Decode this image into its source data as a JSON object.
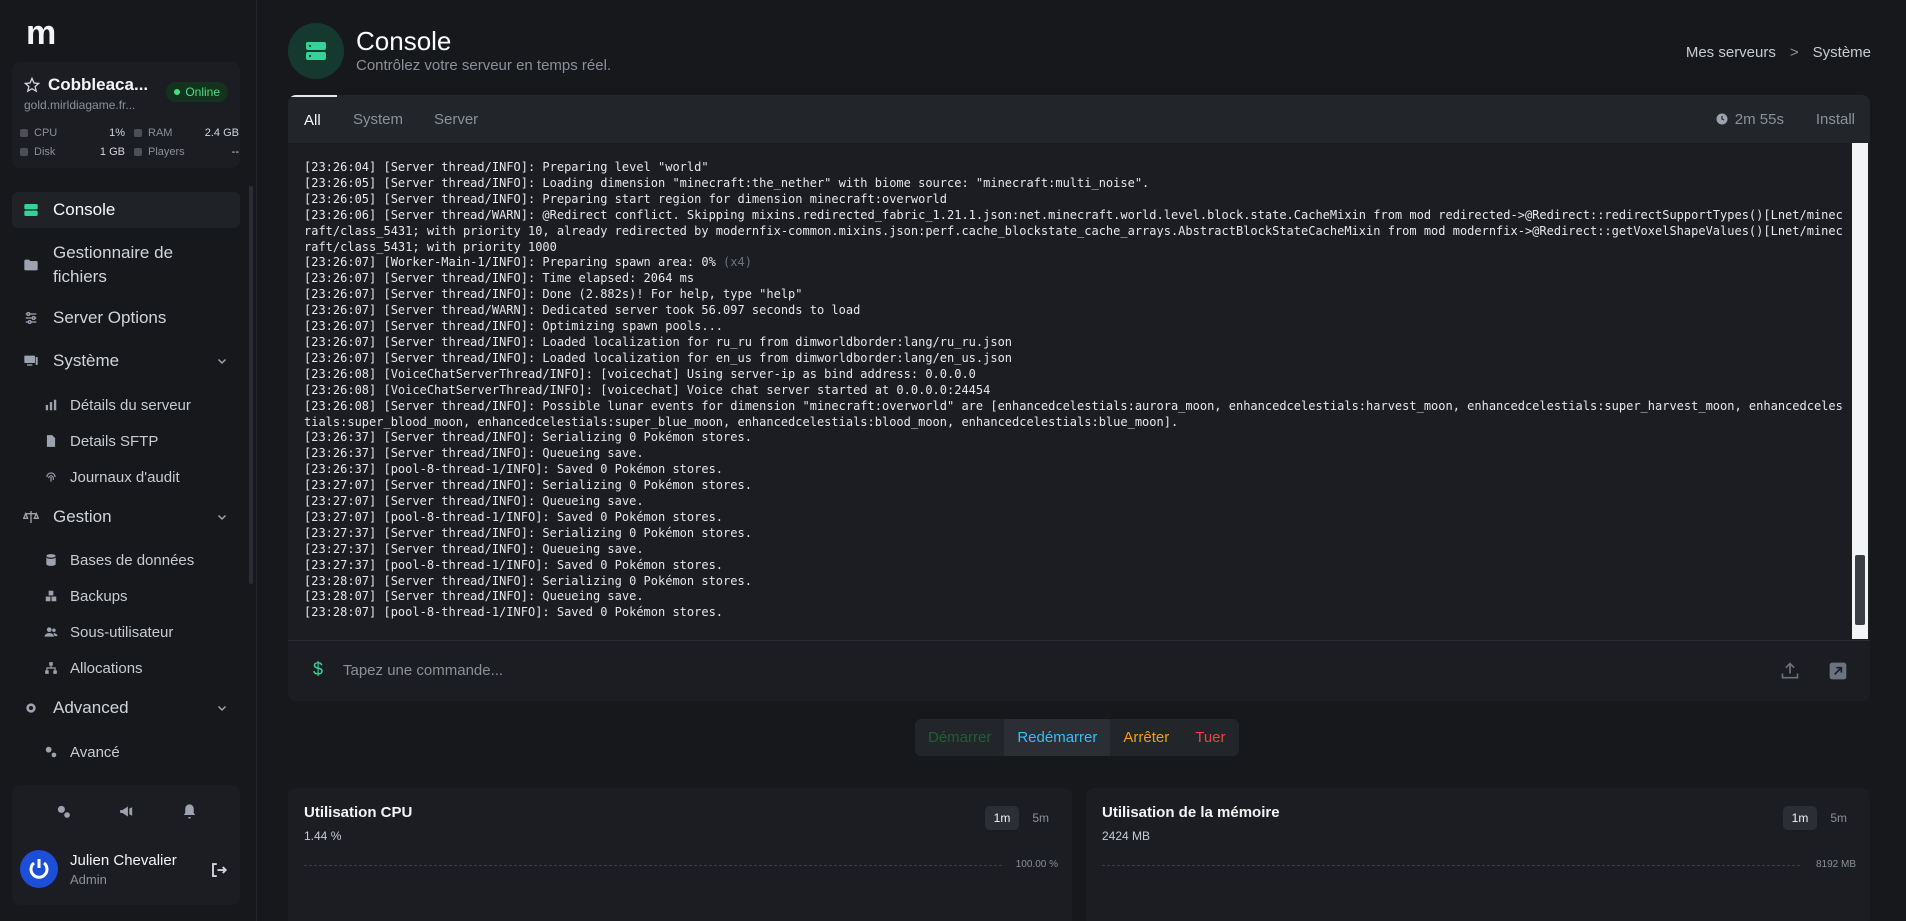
{
  "logo": "m",
  "server": {
    "name": "Cobbleaca...",
    "status": "Online",
    "host": "gold.mirldiagame.fr...",
    "stats": [
      {
        "label": "CPU",
        "value": "1%"
      },
      {
        "label": "RAM",
        "value": "2.4 GB"
      },
      {
        "label": "Disk",
        "value": "1 GB"
      },
      {
        "label": "Players",
        "value": "--"
      }
    ]
  },
  "nav": {
    "console": "Console",
    "files_line1": "Gestionnaire de",
    "files_line2": "fichiers",
    "server_options": "Server Options",
    "systeme": "Système",
    "systeme_items": [
      "Détails du serveur",
      "Details SFTP",
      "Journaux d'audit"
    ],
    "gestion": "Gestion",
    "gestion_items": [
      "Bases de données",
      "Backups",
      "Sous-utilisateur",
      "Allocations"
    ],
    "advanced": "Advanced",
    "advanced_items": [
      "Avancé"
    ]
  },
  "user": {
    "name": "Julien Chevalier",
    "role": "Admin"
  },
  "header": {
    "title": "Console",
    "subtitle": "Contrôlez votre serveur en temps réel.",
    "breadcrumb": [
      "Mes serveurs",
      ">",
      "Système"
    ]
  },
  "console": {
    "tabs": [
      "All",
      "System",
      "Server"
    ],
    "uptime": "2m 55s",
    "install": "Install",
    "lines": [
      "[23:26:04] [Server thread/INFO]: Preparing level \"world\"",
      "[23:26:05] [Server thread/INFO]: Loading dimension \"minecraft:the_nether\" with biome source: \"minecraft:multi_noise\".",
      "[23:26:05] [Server thread/INFO]: Preparing start region for dimension minecraft:overworld",
      "[23:26:06] [Server thread/WARN]: @Redirect conflict. Skipping mixins.redirected_fabric_1.21.1.json:net.minecraft.world.level.block.state.CacheMixin from mod redirected->@Redirect::redirectSupportTypes()[Lnet/minecraft/class_5431; with priority 10, already redirected by modernfix-common.mixins.json:perf.cache_blockstate_cache_arrays.AbstractBlockStateCacheMixin from mod modernfix->@Redirect::getVoxelShapeValues()[Lnet/minecraft/class_5431; with priority 1000",
      "[23:26:07] [Worker-Main-1/INFO]: Preparing spawn area: 0%",
      "[23:26:07] [Server thread/INFO]: Time elapsed: 2064 ms",
      "[23:26:07] [Server thread/INFO]: Done (2.882s)! For help, type \"help\"",
      "[23:26:07] [Server thread/WARN]: Dedicated server took 56.097 seconds to load",
      "[23:26:07] [Server thread/INFO]: Optimizing spawn pools...",
      "[23:26:07] [Server thread/INFO]: Loaded localization for ru_ru from dimworldborder:lang/ru_ru.json",
      "[23:26:07] [Server thread/INFO]: Loaded localization for en_us from dimworldborder:lang/en_us.json",
      "[23:26:08] [VoiceChatServerThread/INFO]: [voicechat] Using server-ip as bind address: 0.0.0.0",
      "[23:26:08] [VoiceChatServerThread/INFO]: [voicechat] Voice chat server started at 0.0.0.0:24454",
      "[23:26:08] [Server thread/INFO]: Possible lunar events for dimension \"minecraft:overworld\" are [enhancedcelestials:aurora_moon, enhancedcelestials:harvest_moon, enhancedcelestials:super_harvest_moon, enhancedcelestials:super_blood_moon, enhancedcelestials:super_blue_moon, enhancedcelestials:blood_moon, enhancedcelestials:blue_moon].",
      "[23:26:37] [Server thread/INFO]: Serializing 0 Pokémon stores.",
      "[23:26:37] [Server thread/INFO]: Queueing save.",
      "[23:26:37] [pool-8-thread-1/INFO]: Saved 0 Pokémon stores.",
      "[23:27:07] [Server thread/INFO]: Serializing 0 Pokémon stores.",
      "[23:27:07] [Server thread/INFO]: Queueing save.",
      "[23:27:07] [pool-8-thread-1/INFO]: Saved 0 Pokémon stores.",
      "[23:27:37] [Server thread/INFO]: Serializing 0 Pokémon stores.",
      "[23:27:37] [Server thread/INFO]: Queueing save.",
      "[23:27:37] [pool-8-thread-1/INFO]: Saved 0 Pokémon stores.",
      "[23:28:07] [Server thread/INFO]: Serializing 0 Pokémon stores.",
      "[23:28:07] [Server thread/INFO]: Queueing save.",
      "[23:28:07] [pool-8-thread-1/INFO]: Saved 0 Pokémon stores."
    ],
    "repeat_note": "(x4)",
    "repeat_line_index": 4,
    "command_placeholder": "Tapez une commande..."
  },
  "power": {
    "start": "Démarrer",
    "restart": "Redémarrer",
    "stop": "Arrêter",
    "kill": "Tuer"
  },
  "graphs": {
    "cpu": {
      "title": "Utilisation CPU",
      "value": "1.44 %",
      "ranges": [
        "1m",
        "5m"
      ],
      "max": "100.00 %"
    },
    "memory": {
      "title": "Utilisation de la mémoire",
      "value": "2424 MB",
      "ranges": [
        "1m",
        "5m"
      ],
      "max": "8192 MB"
    }
  },
  "colors": {
    "accent": "#34d399",
    "online": "#4ade80",
    "restart": "#38bdf8",
    "stop": "#f59e0b",
    "kill": "#ef4444"
  }
}
